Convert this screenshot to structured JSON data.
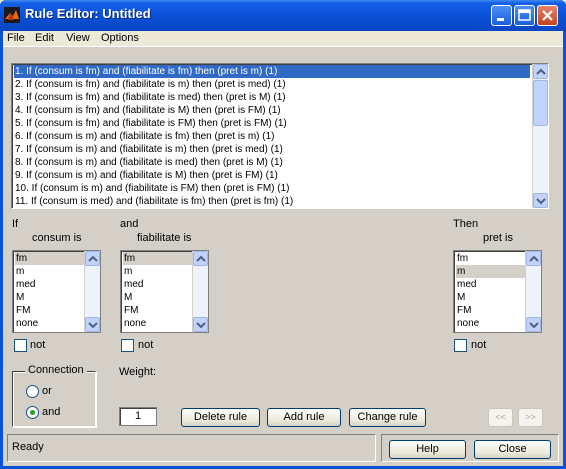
{
  "window": {
    "title": "Rule Editor: Untitled"
  },
  "menubar": {
    "items": [
      "File",
      "Edit",
      "View",
      "Options"
    ]
  },
  "rules": [
    "1. If (consum is fm) and (fiabilitate is fm) then (pret is m) (1)",
    "2. If (consum is fm) and (fiabilitate is m) then (pret is med) (1)",
    "3. If (consum is fm) and (fiabilitate is med) then (pret is M) (1)",
    "4. If (consum is fm) and (fiabilitate is M) then (pret is FM) (1)",
    "5. If (consum is fm) and (fiabilitate is FM) then (pret is FM) (1)",
    "6. If (consum is m) and (fiabilitate is fm) then (pret is m) (1)",
    "7. If (consum is m) and (fiabilitate is m) then (pret is med) (1)",
    "8. If (consum is m) and (fiabilitate is med) then (pret is M) (1)",
    "9. If (consum is m) and (fiabilitate is M) then (pret is FM) (1)",
    "10. If (consum is m) and (fiabilitate is FM) then (pret is FM) (1)",
    "11. If (consum is med) and (fiabilitate is fm) then (pret is fm) (1)"
  ],
  "selected_rule_index": 0,
  "inputs": {
    "if_label": "If",
    "and_label": "and",
    "then_label": "Then",
    "consum": {
      "label": "consum is",
      "options": [
        "fm",
        "m",
        "med",
        "M",
        "FM",
        "none"
      ],
      "selected": "fm"
    },
    "fiabilitate": {
      "label": "fiabilitate is",
      "options": [
        "fm",
        "m",
        "med",
        "M",
        "FM",
        "none"
      ],
      "selected": "fm"
    },
    "pret": {
      "label": "pret is",
      "options": [
        "fm",
        "m",
        "med",
        "M",
        "FM",
        "none"
      ],
      "selected": "m"
    },
    "not_label": "not"
  },
  "connection": {
    "title": "Connection",
    "options": [
      "or",
      "and"
    ],
    "selected": "and"
  },
  "weight": {
    "label": "Weight:",
    "value": "1"
  },
  "buttons": {
    "delete_rule": "Delete rule",
    "add_rule": "Add rule",
    "change_rule": "Change rule",
    "prev": "<<",
    "next": ">>",
    "help": "Help",
    "close": "Close"
  },
  "status": "Ready",
  "colors": {
    "selection": "#316ac5",
    "titlebar": "#0a4fd4"
  }
}
